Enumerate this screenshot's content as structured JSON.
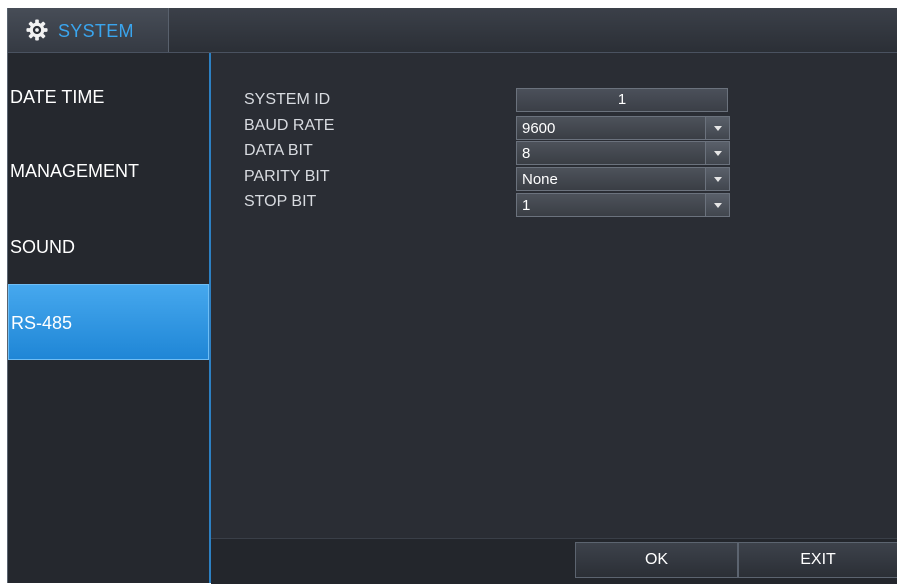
{
  "window": {
    "title": "SYSTEM",
    "title_icon": "gear-icon"
  },
  "sidebar": {
    "items": [
      {
        "label": "DATE TIME",
        "selected": false
      },
      {
        "label": "MANAGEMENT",
        "selected": false
      },
      {
        "label": "SOUND",
        "selected": false
      },
      {
        "label": "RS-485",
        "selected": true
      }
    ]
  },
  "form": {
    "system_id": {
      "label": "SYSTEM ID",
      "value": "1"
    },
    "baud_rate": {
      "label": "BAUD RATE",
      "value": "9600"
    },
    "data_bit": {
      "label": "DATA BIT",
      "value": "8"
    },
    "parity_bit": {
      "label": "PARITY BIT",
      "value": "None"
    },
    "stop_bit": {
      "label": "STOP BIT",
      "value": "1"
    }
  },
  "footer": {
    "ok_label": "OK",
    "exit_label": "EXIT"
  },
  "colors": {
    "accent": "#3aa5ee",
    "selected_nav": "#2f97e2",
    "background": "#2a2d34"
  }
}
